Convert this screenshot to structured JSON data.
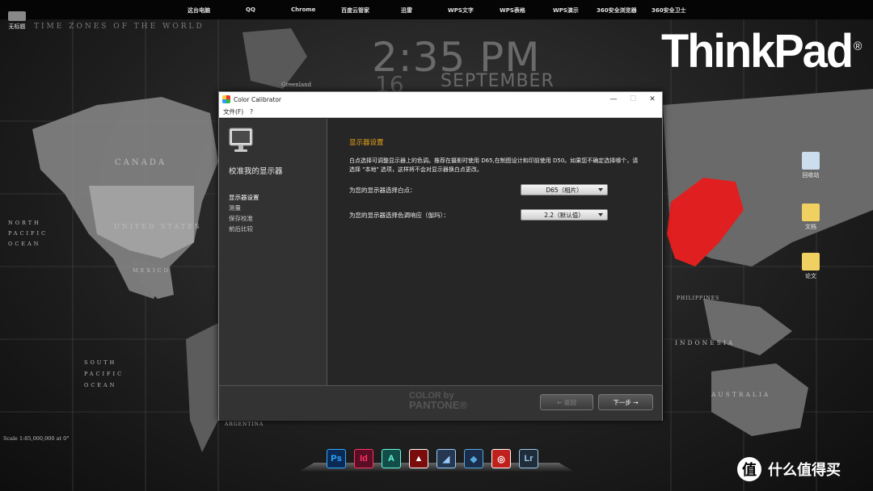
{
  "topbar": {
    "items": [
      "这台电脑",
      "QQ",
      "Chrome",
      "百度云管家",
      "迅雷",
      "WPS文字",
      "WPS表格",
      "WPS演示",
      "360安全浏览器",
      "360安全卫士"
    ]
  },
  "desktop": {
    "untitled_icon": "无标题",
    "recycle_bin": "回收站",
    "document": "文档",
    "paper": "论文"
  },
  "wallpaper": {
    "map_title": "TIME ZONES OF THE WORLD",
    "clock_time": "2:35 PM",
    "clock_day": "16",
    "clock_month": "SEPTEMBER",
    "brand": "ThinkPad",
    "labels": {
      "canada": "CANADA",
      "united_states": "UNITED STATES",
      "mexico": "MEXICO",
      "greenland": "Greenland",
      "north_pacific": "NORTH PACIFIC OCEAN",
      "south_pacific": "SOUTH PACIFIC OCEAN",
      "indonesia": "INDONESIA",
      "australia": "AUSTRALIA",
      "philippines": "PHILIPPINES",
      "argentina": "ARGENTINA",
      "scale": "Scale 1:85,000,000 at 0°"
    }
  },
  "window": {
    "title": "Color Calibrator",
    "controls": {
      "minimize": "—",
      "maximize": "☐",
      "close": "✕"
    },
    "menu": [
      "文件(F)",
      "?"
    ],
    "left": {
      "heading": "校准我的显示器",
      "steps": [
        "显示器设置",
        "测量",
        "保存校准",
        "前后比较"
      ],
      "active_step": 0
    },
    "right": {
      "section_title": "显示器设置",
      "description": "白点选择可调整显示器上的色调。推荐在摄影时使用 D65,在制图设计和印前使用 D50。如果您不确定选择哪个，请选择 \"本地\" 选项，这样将不会对显示器换白点更改。",
      "white_point_label": "为您的显示器选择白点：",
      "white_point_value": "D65（相片）",
      "gamma_label": "为您的显示器选择色调响应（伽玛）：",
      "gamma_value": "2.2（默认值）"
    },
    "footer": {
      "pantone_line1": "COLOR by",
      "pantone_line2": "PANTONE®",
      "back_label": "← 返回",
      "next_label": "下一步 →"
    }
  },
  "dock": {
    "apps": [
      {
        "name": "photoshop",
        "label": "Ps",
        "bg": "#0a2a55",
        "fg": "#31a8ff"
      },
      {
        "name": "indesign",
        "label": "Id",
        "bg": "#5a0d24",
        "fg": "#ff3366"
      },
      {
        "name": "muse",
        "label": "A",
        "bg": "#134d4a",
        "fg": "#6fd"
      },
      {
        "name": "acrobat",
        "label": "▲",
        "bg": "#7a0c0c",
        "fg": "#fff"
      },
      {
        "name": "app-5",
        "label": "◢",
        "bg": "#25384f",
        "fg": "#9cf"
      },
      {
        "name": "app-6",
        "label": "◆",
        "bg": "#1b2d4a",
        "fg": "#5ad"
      },
      {
        "name": "app-7",
        "label": "◎",
        "bg": "#c0201c",
        "fg": "#fff"
      },
      {
        "name": "lightroom",
        "label": "Lr",
        "bg": "#1f2d3a",
        "fg": "#9cc8ea"
      }
    ]
  },
  "watermark": {
    "logo": "值",
    "text": "什么值得买"
  },
  "colors": {
    "accent_orange": "#e8a319",
    "china_red": "#e02020"
  }
}
